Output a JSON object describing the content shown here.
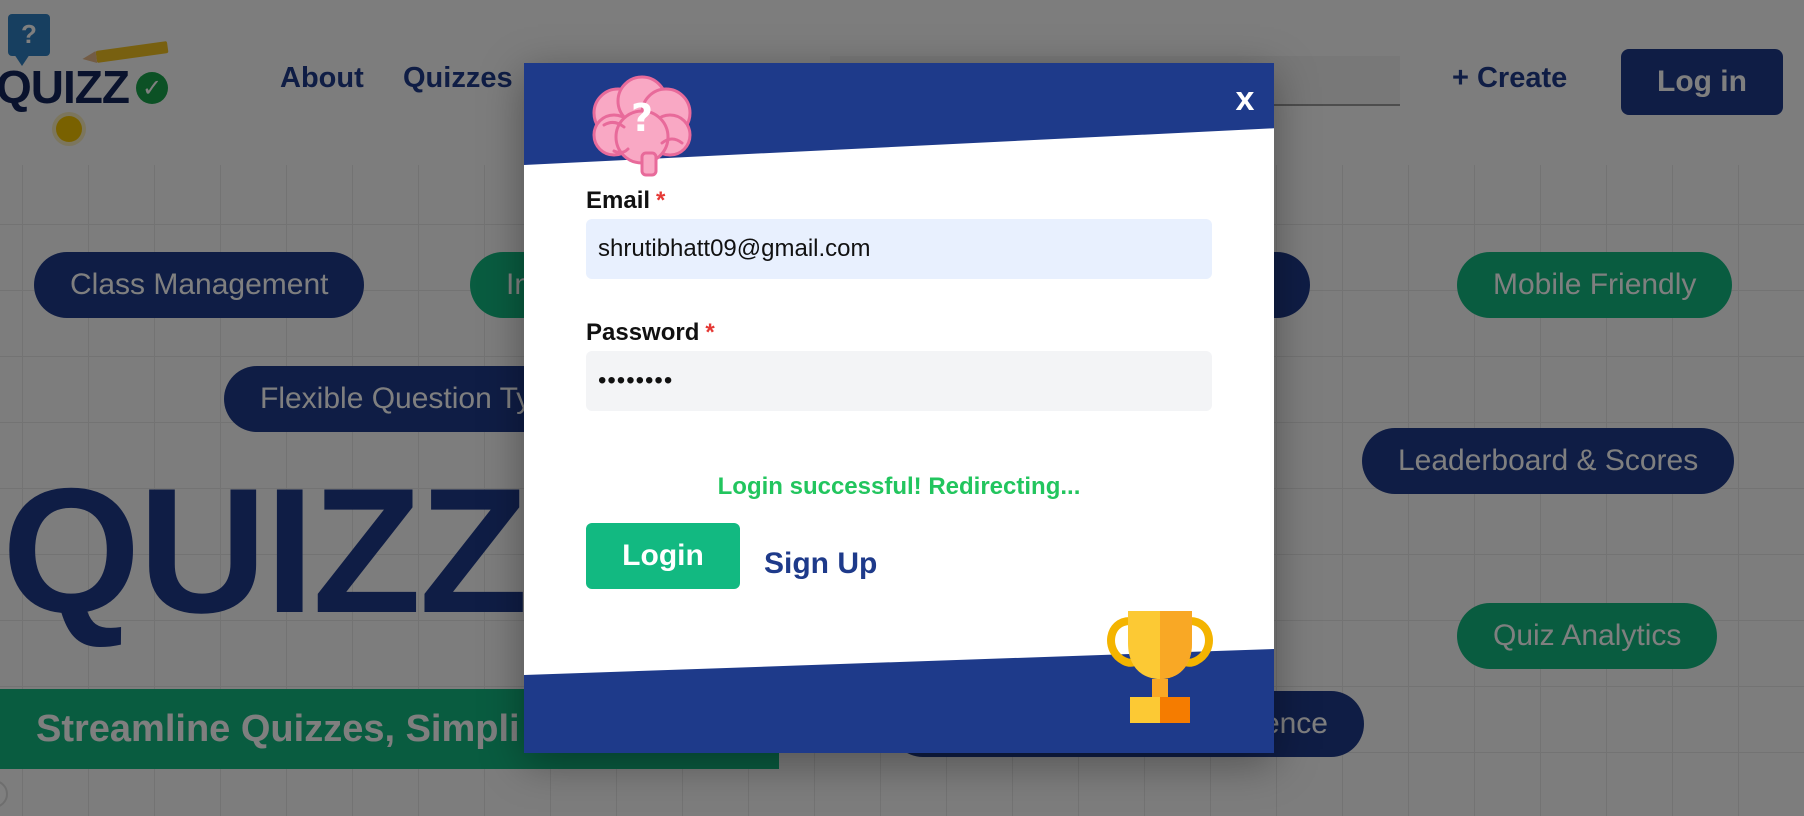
{
  "header": {
    "logo_badge": "?",
    "logo_text": "QUIZZ",
    "logo_check": "✓",
    "nav": {
      "about": "About",
      "quizzes": "Quizzes"
    },
    "search_placeholder": "",
    "create_label": "+ Create",
    "login_label": "Log in"
  },
  "features": {
    "class_management": "Class Management",
    "interactive": "In",
    "mobile_friendly": "Mobile Friendly",
    "flexible_questions": "Flexible Question Ty",
    "leaderboard": "Leaderboard & Scores",
    "quiz_analytics": "Quiz Analytics",
    "confidence": "ence"
  },
  "hero": {
    "title": "QUIZZ",
    "tagline": "Streamline Quizzes, Simpli"
  },
  "modal": {
    "close_label": "x",
    "email_label": "Email",
    "password_label": "Password",
    "required_mark": "*",
    "email_value": "shrutibhatt09@gmail.com",
    "password_value": "••••••••",
    "status_message": "Login successful! Redirecting...",
    "login_button": "Login",
    "signup_link": "Sign Up"
  },
  "colors": {
    "brand_navy": "#1e3a8a",
    "brand_green": "#12b981",
    "success_text": "#22c55e",
    "required_red": "#e53935",
    "email_field_bg": "#e8f0fe"
  },
  "icons": {
    "modal_top": "brain-question-icon",
    "modal_bottom": "trophy-icon",
    "close": "close-icon"
  }
}
